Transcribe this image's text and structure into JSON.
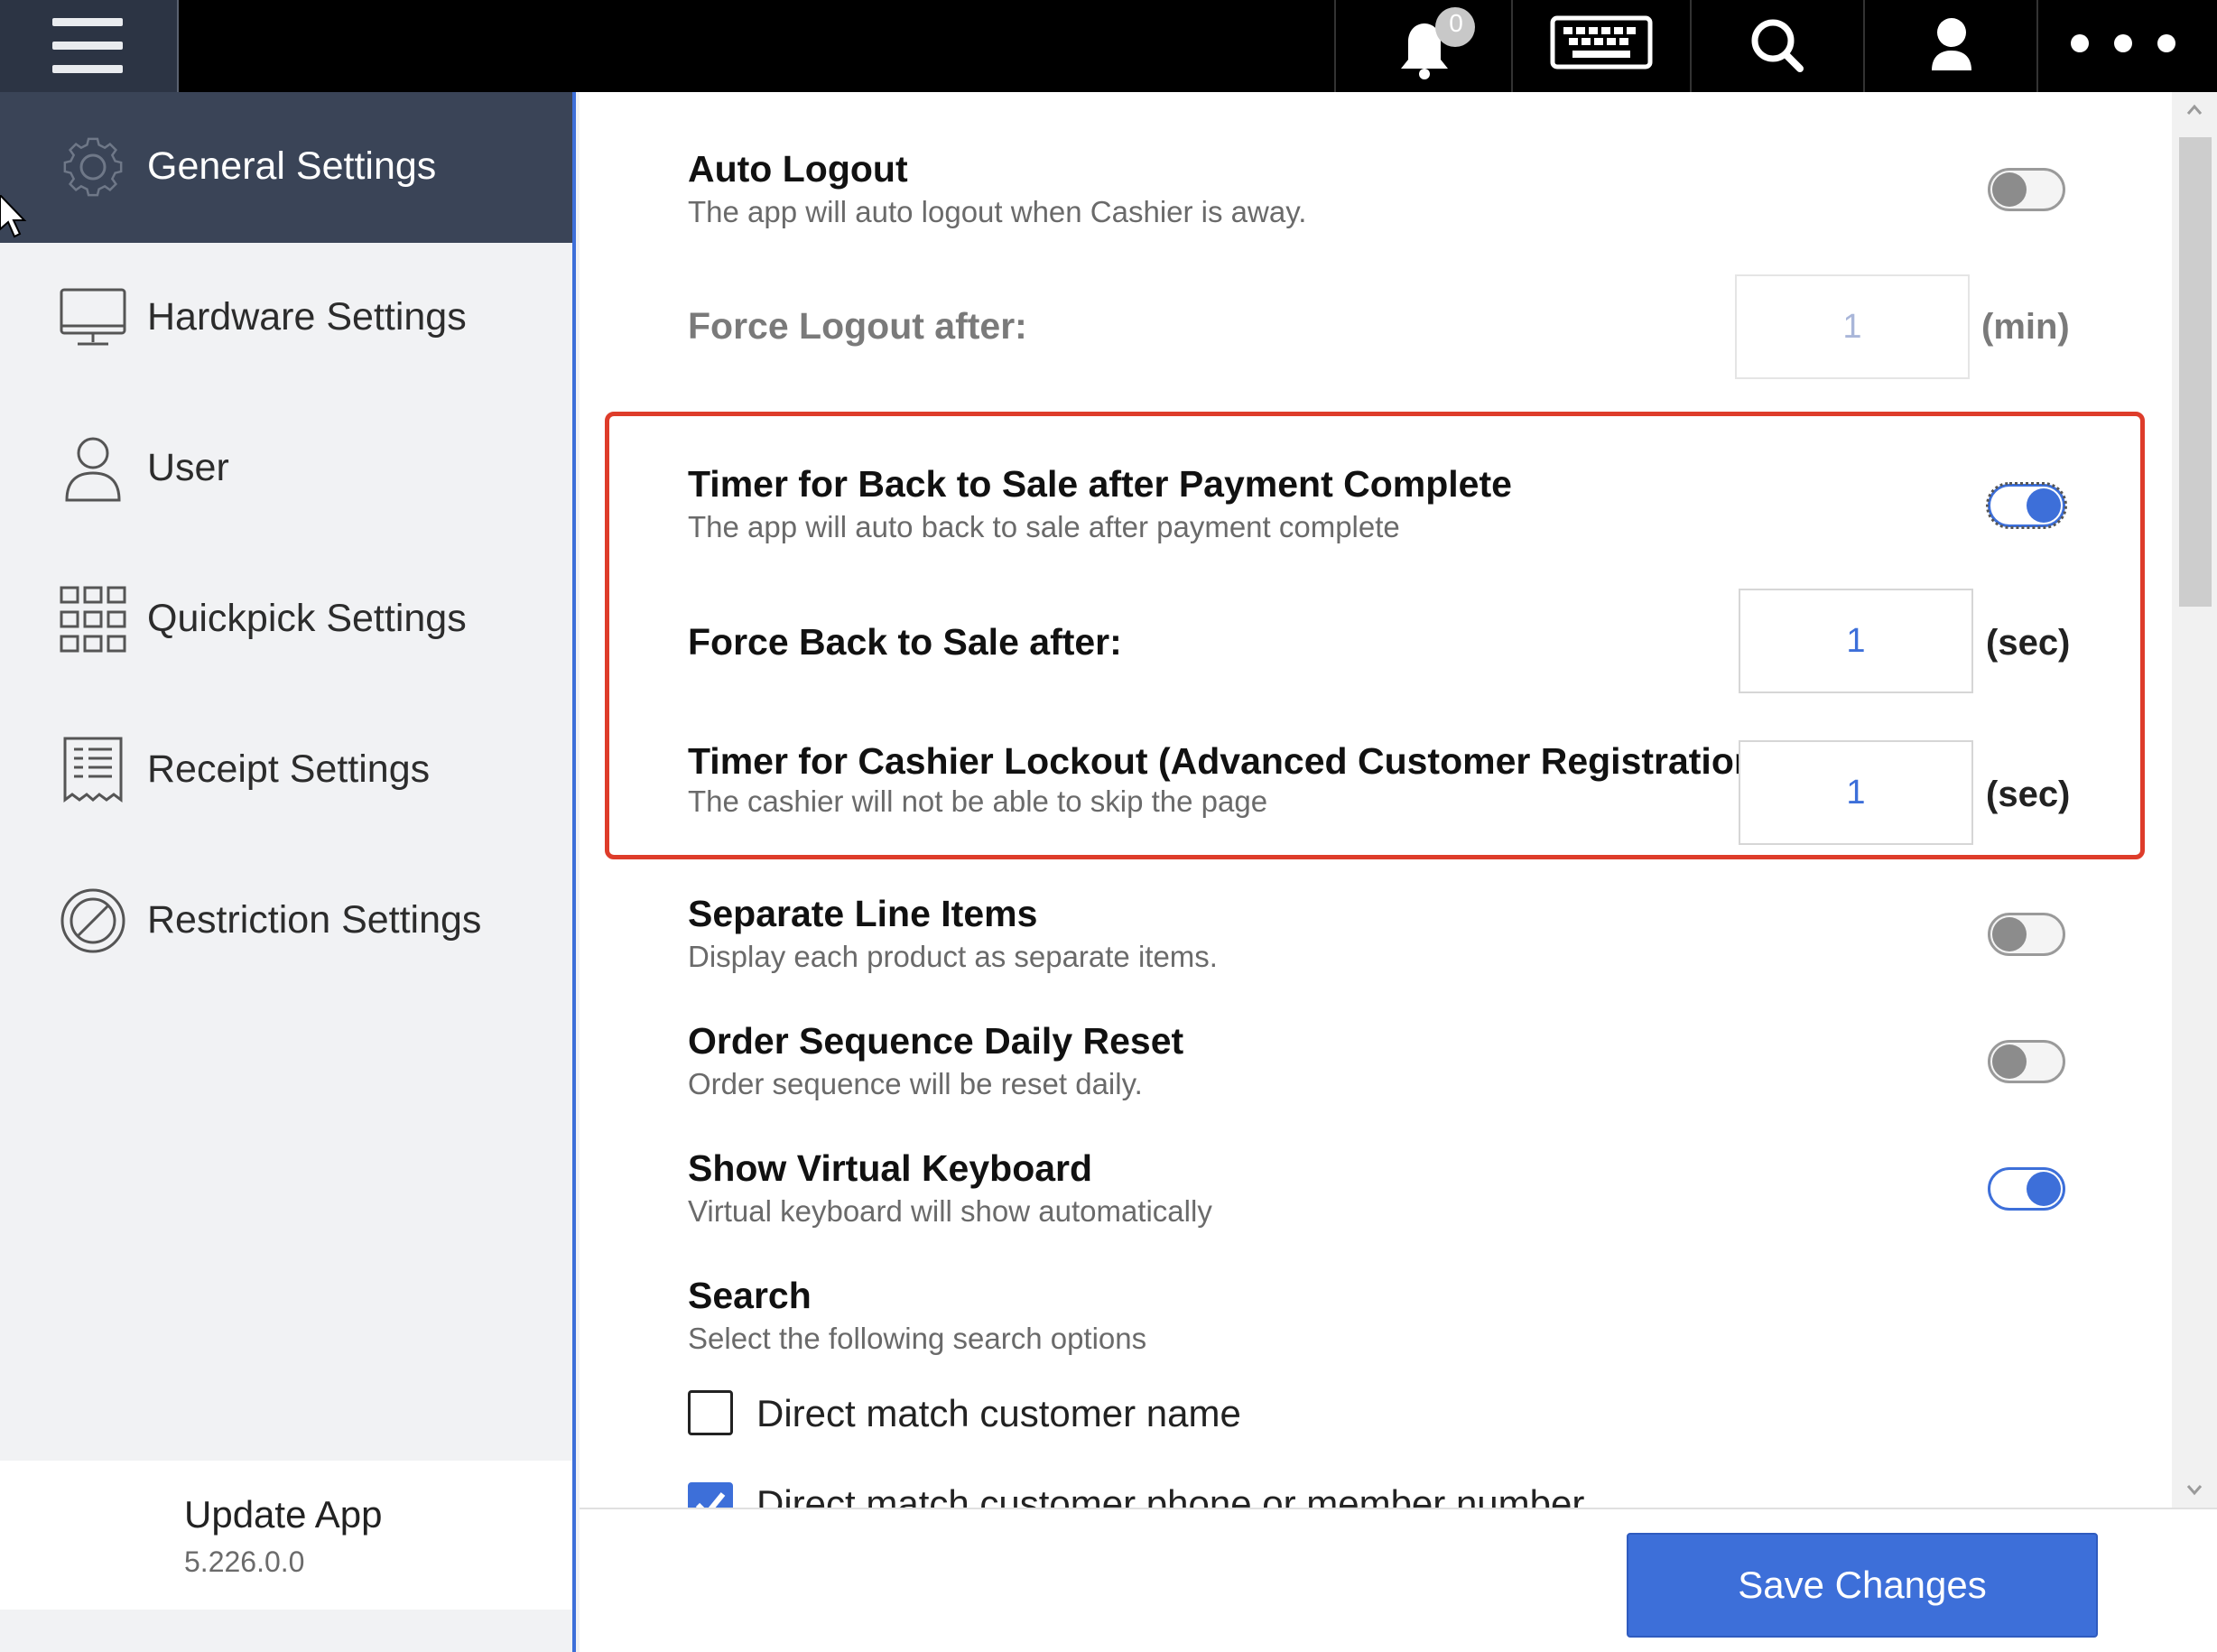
{
  "topbar": {
    "notification_count": "0",
    "icons": [
      "hamburger-menu-icon",
      "bell-icon",
      "keyboard-icon",
      "search-icon",
      "user-icon",
      "more-icon"
    ]
  },
  "sidebar": {
    "items": [
      {
        "label": "General Settings",
        "icon": "gear-icon",
        "active": true
      },
      {
        "label": "Hardware Settings",
        "icon": "monitor-icon",
        "active": false
      },
      {
        "label": "User",
        "icon": "user-icon",
        "active": false
      },
      {
        "label": "Quickpick Settings",
        "icon": "grid-icon",
        "active": false
      },
      {
        "label": "Receipt Settings",
        "icon": "receipt-icon",
        "active": false
      },
      {
        "label": "Restriction Settings",
        "icon": "restriction-icon",
        "active": false
      }
    ],
    "update": {
      "title": "Update App",
      "version": "5.226.0.0"
    }
  },
  "settings": {
    "auto_logout": {
      "title": "Auto Logout",
      "desc": "The app will auto logout when Cashier is away.",
      "enabled": false
    },
    "force_logout": {
      "label": "Force Logout after:",
      "value": "1",
      "unit": "(min)"
    },
    "back_to_sale": {
      "title": "Timer for Back to Sale after Payment Complete",
      "desc": "The app will auto back to sale after payment complete",
      "enabled": true
    },
    "force_back_to_sale": {
      "label": "Force Back to Sale after:",
      "value": "1",
      "unit": "(sec)"
    },
    "cashier_lockout": {
      "title": "Timer for Cashier Lockout (Advanced Customer Registration)",
      "desc": "The cashier will not be able to skip the page",
      "value": "1",
      "unit": "(sec)"
    },
    "separate_line_items": {
      "title": "Separate Line Items",
      "desc": "Display each product as separate items.",
      "enabled": false
    },
    "order_sequence_reset": {
      "title": "Order Sequence Daily Reset",
      "desc": "Order sequence will be reset daily.",
      "enabled": false
    },
    "virtual_keyboard": {
      "title": "Show Virtual Keyboard",
      "desc": "Virtual keyboard will show automatically",
      "enabled": true
    },
    "search": {
      "title": "Search",
      "desc": "Select the following search options",
      "options": [
        {
          "label": "Direct match customer name",
          "checked": false
        },
        {
          "label": "Direct match customer phone or member number",
          "checked": true
        }
      ]
    }
  },
  "footer": {
    "save_label": "Save Changes"
  },
  "colors": {
    "accent": "#3d6fd9",
    "highlight": "#de3c2a",
    "sidebar_active": "#3a4457"
  }
}
